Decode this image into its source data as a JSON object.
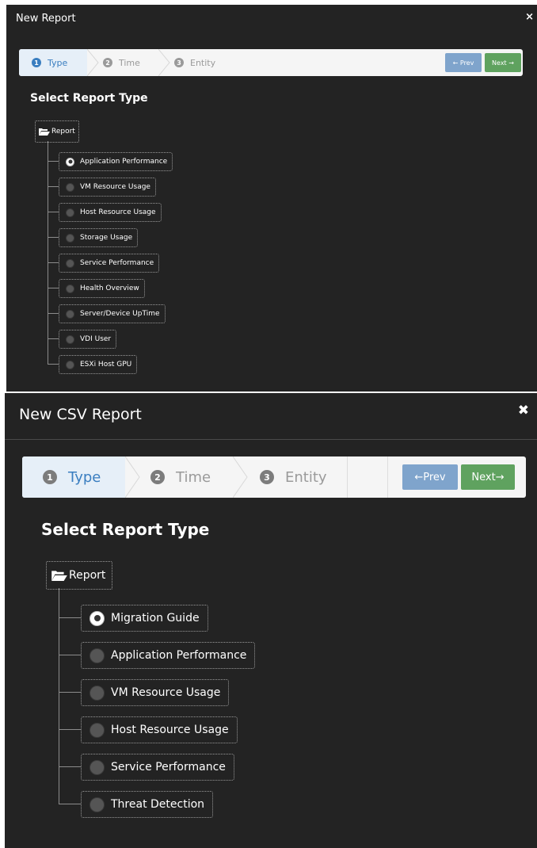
{
  "top_dialog": {
    "title": "New Report",
    "close_glyph": "×",
    "steps": [
      {
        "num": "1",
        "label": "Type",
        "active": true
      },
      {
        "num": "2",
        "label": "Time",
        "active": false
      },
      {
        "num": "3",
        "label": "Entity",
        "active": false
      }
    ],
    "prev_label": "← Prev",
    "next_label": "Next →",
    "heading": "Select Report Type",
    "tree_root_label": "Report",
    "options": [
      {
        "label": "Application Performance",
        "selected": true
      },
      {
        "label": "VM Resource Usage",
        "selected": false
      },
      {
        "label": "Host Resource Usage",
        "selected": false
      },
      {
        "label": "Storage Usage",
        "selected": false
      },
      {
        "label": "Service Performance",
        "selected": false
      },
      {
        "label": "Health Overview",
        "selected": false
      },
      {
        "label": "Server/Device UpTime",
        "selected": false
      },
      {
        "label": "VDI User",
        "selected": false
      },
      {
        "label": "ESXi Host GPU",
        "selected": false
      }
    ]
  },
  "bottom_dialog": {
    "title": "New CSV Report",
    "close_glyph": "✖",
    "steps": [
      {
        "num": "1",
        "label": "Type",
        "active": true
      },
      {
        "num": "2",
        "label": "Time",
        "active": false
      },
      {
        "num": "3",
        "label": "Entity",
        "active": false
      }
    ],
    "prev_label": "←Prev",
    "next_label": "Next→",
    "heading": "Select Report Type",
    "tree_root_label": "Report",
    "options": [
      {
        "label": "Migration Guide",
        "selected": true
      },
      {
        "label": "Application Performance",
        "selected": false
      },
      {
        "label": "VM Resource Usage",
        "selected": false
      },
      {
        "label": "Host Resource Usage",
        "selected": false
      },
      {
        "label": "Service Performance",
        "selected": false
      },
      {
        "label": "Threat Detection",
        "selected": false
      }
    ]
  },
  "colors": {
    "panel_bg": "#232323",
    "active_step": "#3a7ec0",
    "prev_button": "#7fa4cc",
    "next_button": "#5fa25f"
  },
  "icons": [
    "close-icon",
    "folder-open-icon",
    "radio-icon",
    "arrow-left-icon",
    "arrow-right-icon"
  ]
}
